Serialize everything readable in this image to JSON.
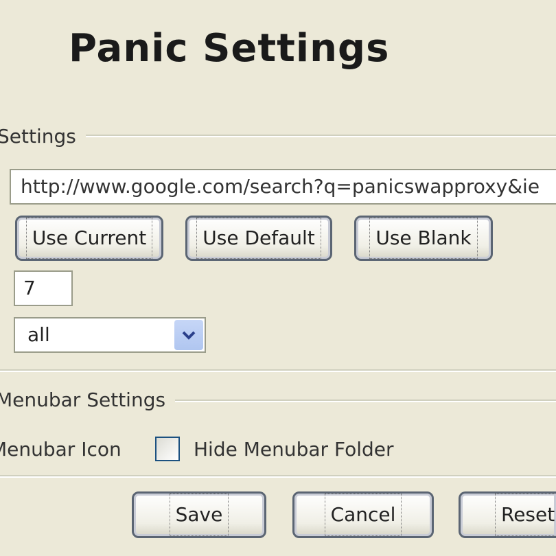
{
  "page": {
    "title": "Panic Settings"
  },
  "settings_group": {
    "label": "Settings",
    "url_value": "http://www.google.com/search?q=panicswapproxy&ie",
    "buttons": {
      "use_current": "Use Current",
      "use_default": "Use Default",
      "use_blank": "Use Blank"
    },
    "number_value": "7",
    "select_value": "all"
  },
  "menubar_group": {
    "label": "Menubar Settings",
    "icon_label": "Menubar Icon",
    "hide_folder_label": "Hide Menubar Folder",
    "hide_folder_checked": false
  },
  "footer": {
    "save_label": "Save",
    "cancel_label": "Cancel",
    "reset_label": "Reset"
  },
  "icons": {
    "dropdown": "chevron-down-icon"
  },
  "colors": {
    "window_bg": "#ece9d8",
    "dropdown_accent": "#b0c6f0",
    "button_border": "#5b6573"
  }
}
